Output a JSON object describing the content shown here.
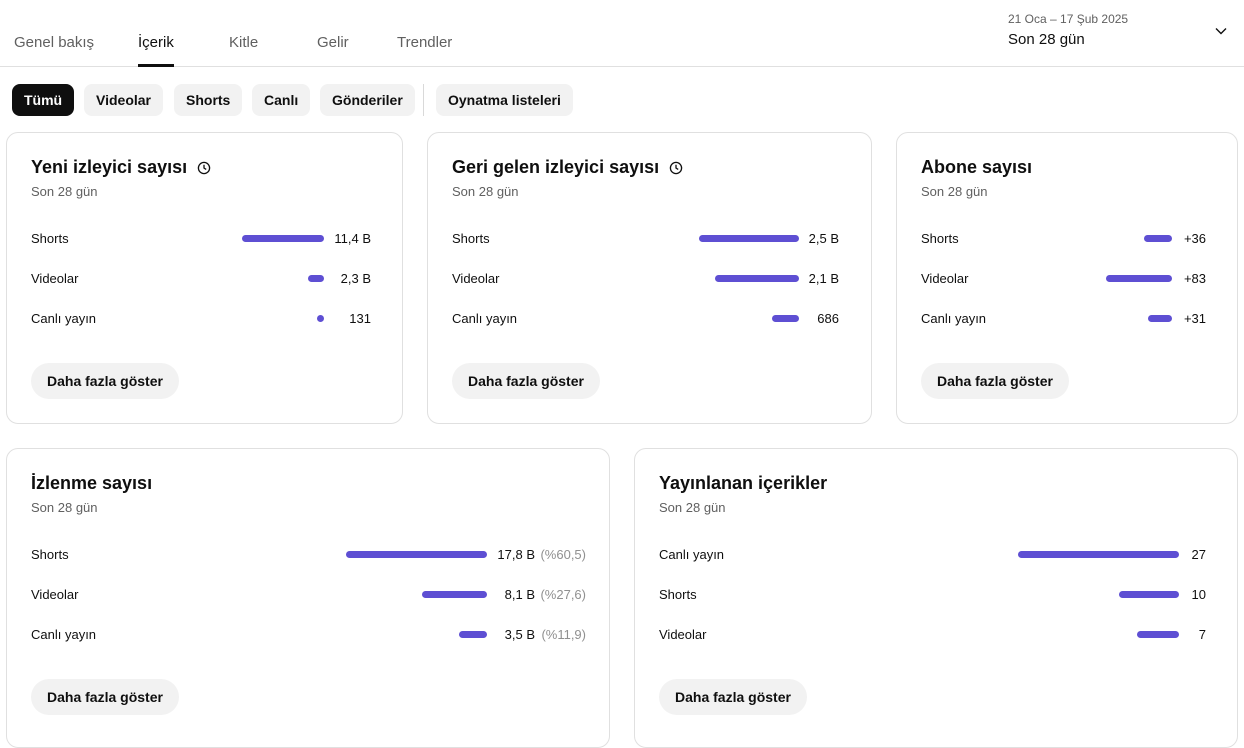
{
  "tabs": [
    {
      "label": "Genel bakış",
      "active": false
    },
    {
      "label": "İçerik",
      "active": true
    },
    {
      "label": "Kitle",
      "active": false
    },
    {
      "label": "Gelir",
      "active": false
    },
    {
      "label": "Trendler",
      "active": false
    }
  ],
  "date_picker": {
    "range": "21 Oca – 17 Şub 2025",
    "label": "Son 28 gün"
  },
  "chips": [
    {
      "label": "Tümü",
      "selected": true
    },
    {
      "label": "Videolar",
      "selected": false
    },
    {
      "label": "Shorts",
      "selected": false
    },
    {
      "label": "Canlı",
      "selected": false
    },
    {
      "label": "Gönderiler",
      "selected": false
    },
    {
      "label": "Oynatma listeleri",
      "selected": false
    }
  ],
  "accent_color": "#5e4fd3",
  "cards": {
    "new_viewers": {
      "title": "Yeni izleyici sayısı",
      "subtitle": "Son 28 gün",
      "icon": "clock-icon",
      "rows": [
        {
          "label": "Shorts",
          "value": "11,4 B",
          "share": 1.0
        },
        {
          "label": "Videolar",
          "value": "2,3 B",
          "share": 0.2
        },
        {
          "label": "Canlı yayın",
          "value": "131",
          "share": 0.01
        }
      ],
      "button": "Daha fazla göster"
    },
    "returning_viewers": {
      "title": "Geri gelen izleyici sayısı",
      "subtitle": "Son 28 gün",
      "icon": "clock-icon",
      "rows": [
        {
          "label": "Shorts",
          "value": "2,5 B",
          "share": 1.0
        },
        {
          "label": "Videolar",
          "value": "2,1 B",
          "share": 0.84
        },
        {
          "label": "Canlı yayın",
          "value": "686",
          "share": 0.27
        }
      ],
      "button": "Daha fazla göster"
    },
    "subscribers": {
      "title": "Abone sayısı",
      "subtitle": "Son 28 gün",
      "rows": [
        {
          "label": "Shorts",
          "value": "+36",
          "share": 0.43
        },
        {
          "label": "Videolar",
          "value": "+83",
          "share": 1.0
        },
        {
          "label": "Canlı yayın",
          "value": "+31",
          "share": 0.37
        }
      ],
      "button": "Daha fazla göster"
    },
    "views": {
      "title": "İzlenme sayısı",
      "subtitle": "Son 28 gün",
      "rows": [
        {
          "label": "Shorts",
          "value": "17,8 B",
          "pct": "(%60,5)",
          "share": 1.0
        },
        {
          "label": "Videolar",
          "value": "8,1 B",
          "pct": "(%27,6)",
          "share": 0.46
        },
        {
          "label": "Canlı yayın",
          "value": "3,5 B",
          "pct": "(%11,9)",
          "share": 0.2
        }
      ],
      "button": "Daha fazla göster"
    },
    "published": {
      "title": "Yayınlanan içerikler",
      "subtitle": "Son 28 gün",
      "rows": [
        {
          "label": "Canlı yayın",
          "value": "27",
          "share": 1.0
        },
        {
          "label": "Shorts",
          "value": "10",
          "share": 0.37
        },
        {
          "label": "Videolar",
          "value": "7",
          "share": 0.26
        }
      ],
      "button": "Daha fazla göster"
    }
  }
}
